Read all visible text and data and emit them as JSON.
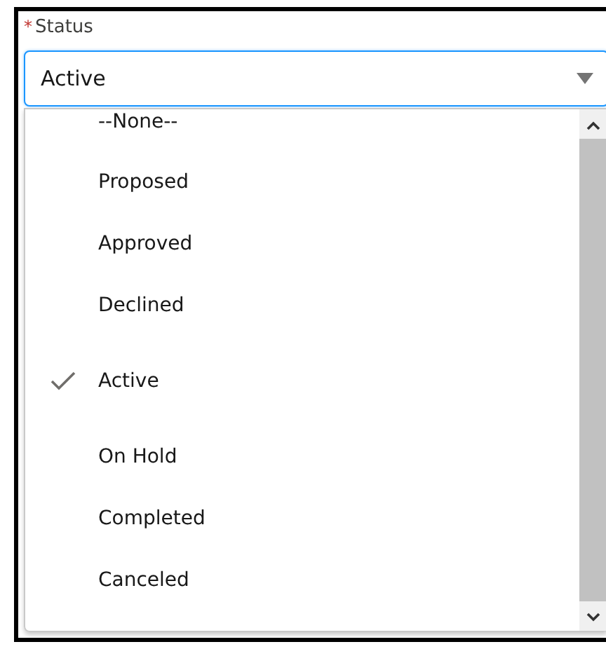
{
  "field": {
    "required_mark": "*",
    "label": "Status",
    "value": "Active"
  },
  "options": [
    {
      "label": "--None--",
      "selected": false
    },
    {
      "label": "Proposed",
      "selected": false
    },
    {
      "label": "Approved",
      "selected": false
    },
    {
      "label": "Declined",
      "selected": false
    },
    {
      "label": "Active",
      "selected": true
    },
    {
      "label": "On Hold",
      "selected": false
    },
    {
      "label": "Completed",
      "selected": false
    },
    {
      "label": "Canceled",
      "selected": false
    }
  ]
}
